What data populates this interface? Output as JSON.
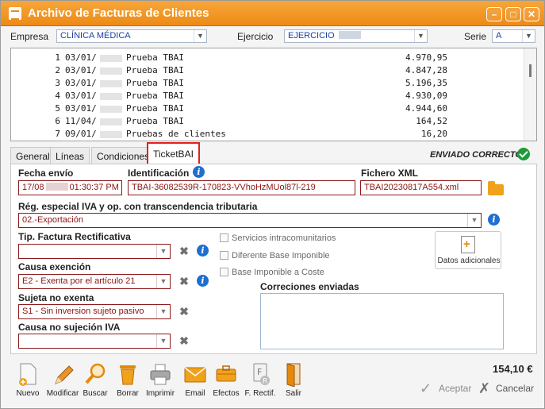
{
  "window": {
    "title": "Archivo de Facturas de Clientes"
  },
  "header": {
    "empresa_label": "Empresa",
    "empresa_value": "CLÍNICA MÉDICA",
    "ejercicio_label": "Ejercicio",
    "ejercicio_value": "EJERCICIO",
    "serie_label": "Serie",
    "serie_value": "A"
  },
  "invoices": [
    {
      "n": "1",
      "date": "03/01/",
      "desc": "Prueba TBAI",
      "amount": "4.970,95"
    },
    {
      "n": "2",
      "date": "03/01/",
      "desc": "Prueba TBAI",
      "amount": "4.847,28"
    },
    {
      "n": "3",
      "date": "03/01/",
      "desc": "Prueba TBAI",
      "amount": "5.196,35"
    },
    {
      "n": "4",
      "date": "03/01/",
      "desc": "Prueba TBAI",
      "amount": "4.930,09"
    },
    {
      "n": "5",
      "date": "03/01/",
      "desc": "Prueba TBAI",
      "amount": "4.944,60"
    },
    {
      "n": "6",
      "date": "11/04/",
      "desc": "Prueba TBAI",
      "amount": "164,52"
    },
    {
      "n": "7",
      "date": "09/01/",
      "desc": "Pruebas de clientes",
      "amount": "16,20"
    }
  ],
  "tabs": [
    "General",
    "Líneas",
    "Condiciones",
    "TicketBAI"
  ],
  "status": {
    "text": "ENVIADO CORRECTO",
    "color": "#1e9a3a"
  },
  "form": {
    "fecha_envio_label": "Fecha envío",
    "fecha_envio_prefix": "17/08",
    "fecha_envio_suffix": "01:30:37 PM",
    "identificacion_label": "Identificación",
    "identificacion_value": "TBAI-36082539R-170823-VVhoHzMUol87l-219",
    "fichero_label": "Fichero XML",
    "fichero_value": "TBAI20230817A554.xml",
    "regimen_label": "Rég. especial IVA y op. con transcendencia tributaria",
    "regimen_value": "02.-Exportación",
    "tip_factura_label": "Tip. Factura Rectificativa",
    "tip_factura_value": "",
    "causa_exencion_label": "Causa exención",
    "causa_exencion_value": "E2 - Exenta por el artículo 21",
    "sujeta_label": "Sujeta no exenta",
    "sujeta_value": "S1 - Sin inversion sujeto pasivo",
    "no_sujecion_label": "Causa no sujeción IVA",
    "no_sujecion_value": "",
    "chk_intracom": "Servicios intracomunitarios",
    "chk_diferente": "Diferente Base Imponible",
    "chk_base_coste": "Base Imponible a Coste",
    "datos_adicionales": "Datos adicionales",
    "correcciones_label": "Correciones enviadas"
  },
  "toolbar": {
    "nuevo": "Nuevo",
    "modificar": "Modificar",
    "buscar": "Buscar",
    "borrar": "Borrar",
    "imprimir": "Imprimir",
    "email": "Email",
    "efectos": "Efectos",
    "f_rectif": "F. Rectif.",
    "salir": "Salir",
    "total": "154,10 €",
    "aceptar": "Aceptar",
    "cancelar": "Cancelar"
  },
  "colors": {
    "titlebar": "#ee8a16",
    "required_border": "#8a1a1a",
    "active_tab_outline": "#e02020"
  }
}
